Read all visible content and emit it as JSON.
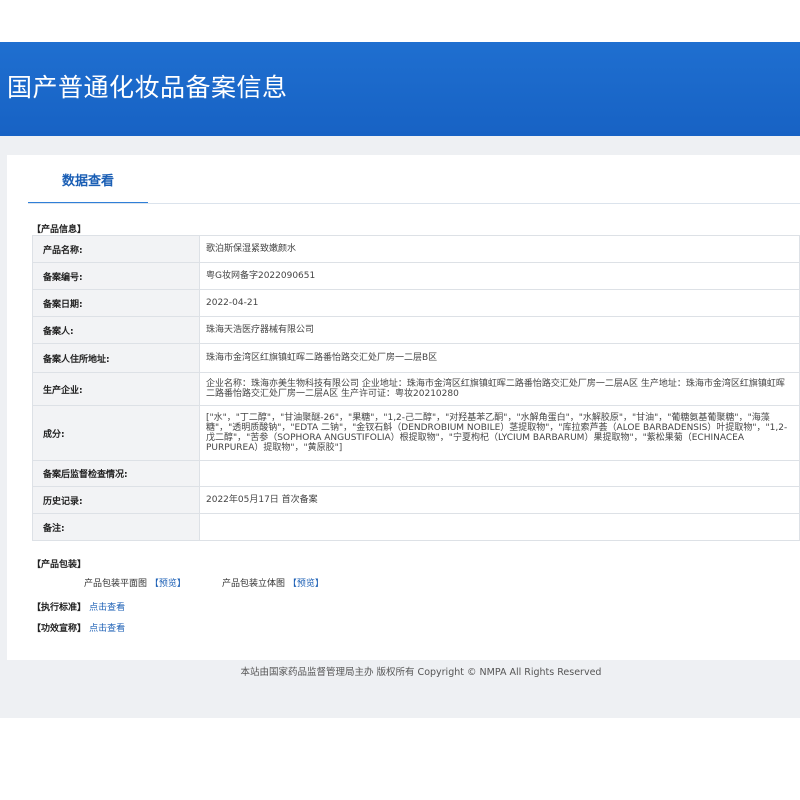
{
  "banner": {
    "title": "国产普通化妆品备案信息"
  },
  "tabs": [
    {
      "label": "数据查看"
    }
  ],
  "product_info": {
    "section_label": "【产品信息】",
    "rows": [
      {
        "label": "产品名称:",
        "value": "歌泊斯保湿紧致嫩颜水"
      },
      {
        "label": "备案编号:",
        "value": "粤G妆网备字2022090651"
      },
      {
        "label": "备案日期:",
        "value": "2022-04-21"
      },
      {
        "label": "备案人:",
        "value": "珠海天浩医疗器械有限公司"
      },
      {
        "label": "备案人住所地址:",
        "value": "珠海市金湾区红旗镇虹晖二路番怡路交汇处厂房一二层B区"
      },
      {
        "label": "生产企业:",
        "value": "企业名称：珠海亦美生物科技有限公司 企业地址：珠海市金湾区红旗镇虹晖二路番怡路交汇处厂房一二层A区 生产地址：珠海市金湾区红旗镇虹晖二路番怡路交汇处厂房一二层A区 生产许可证：粤妆20210280"
      },
      {
        "label": "成分:",
        "value": "[\"水\"，\"丁二醇\"，\"甘油聚醚-26\"，\"果糖\"，\"1,2-己二醇\"，\"对羟基苯乙酮\"，\"水解角蛋白\"，\"水解胶原\"，\"甘油\"，\"葡糖氨基葡聚糖\"，\"海藻糖\"，\"透明质酸钠\"，\"EDTA 二钠\"，\"金钗石斛（DENDROBIUM NOBILE）茎提取物\"，\"库拉索芦荟（ALOE BARBADENSIS）叶提取物\"，\"1,2-戊二醇\"，\"苦参（SOPHORA ANGUSTIFOLIA）根提取物\"，\"宁夏枸杞（LYCIUM BARBARUM）果提取物\"，\"紫松果菊（ECHINACEA PURPUREA）提取物\"，\"黄原胶\"]"
      },
      {
        "label": "备案后监督检查情况:",
        "value": ""
      },
      {
        "label": "历史记录:",
        "value": "2022年05月17日 首次备案"
      },
      {
        "label": "备注:",
        "value": ""
      }
    ]
  },
  "packaging": {
    "section_label": "【产品包装】",
    "flat_label": "产品包装平面图",
    "flat_link": "【预览】",
    "solid_label": "产品包装立体图",
    "solid_link": "【预览】"
  },
  "standard": {
    "label": "【执行标准】",
    "link": "点击查看"
  },
  "efficacy": {
    "label": "【功效宣称】",
    "link": "点击查看"
  },
  "footer": {
    "text": "本站由国家药品监督管理局主办 版权所有 Copyright © NMPA All Rights Reserved"
  }
}
